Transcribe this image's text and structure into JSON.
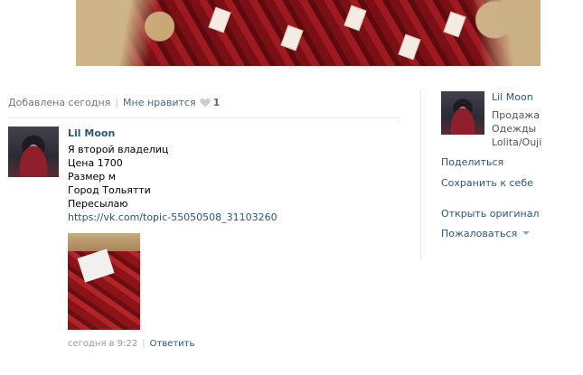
{
  "post": {
    "added_label": "Добавлена сегодня",
    "like_label": "Мне нравится",
    "like_count": "1"
  },
  "comment": {
    "author": "Lil Moon",
    "lines": [
      "Я второй владелиц",
      "Цена 1700",
      "Размер м",
      "Город Тольятти",
      "Пересылаю"
    ],
    "link": "https://vk.com/topic-55050508_31103260",
    "time": "сегодня в 9:22",
    "reply_label": "Ответить"
  },
  "sidebar": {
    "owner_name": "Lil Moon",
    "owner_desc": "Продажа Одежды Lolita/Ouji",
    "share_label": "Поделиться",
    "save_label": "Сохранить к себе",
    "open_original_label": "Открыть оригинал",
    "report_label": "Пожаловаться"
  },
  "colors": {
    "link": "#2b587a",
    "meta": "#777777",
    "divider": "#e4e8ed"
  },
  "icons": {
    "like": "heart-icon",
    "report_menu": "caret-down-icon"
  }
}
